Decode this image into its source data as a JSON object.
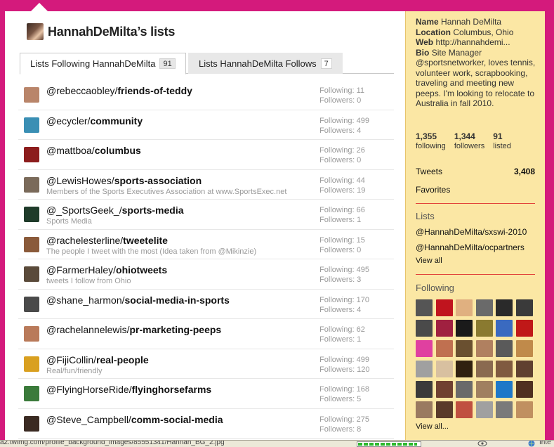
{
  "heading": {
    "title": "HannahDeMilta’s lists"
  },
  "tabs": [
    {
      "label": "Lists Following HannahDeMilta",
      "count": "91"
    },
    {
      "label": "Lists HannahDeMilta Follows",
      "count": "7"
    }
  ],
  "lists": [
    {
      "owner": "@rebeccaobley/",
      "name": "friends-of-teddy",
      "desc": "",
      "following": "Following: 11",
      "followers": "Followers: 0",
      "avatar": "#b9856a"
    },
    {
      "owner": "@ecycler/",
      "name": "community",
      "desc": "",
      "following": "Following: 499",
      "followers": "Followers: 4",
      "avatar": "#3a8fb4"
    },
    {
      "owner": "@mattboa/",
      "name": "columbus",
      "desc": "",
      "following": "Following: 26",
      "followers": "Followers: 0",
      "avatar": "#8c1d1d"
    },
    {
      "owner": "@LewisHowes/",
      "name": "sports-association",
      "desc": "Members of the Sports Executives Association at www.SportsExec.net",
      "following": "Following: 44",
      "followers": "Followers: 19",
      "avatar": "#7a6a5a"
    },
    {
      "owner": "@_SportsGeek_/",
      "name": "sports-media",
      "desc": "Sports Media",
      "following": "Following: 66",
      "followers": "Followers: 1",
      "avatar": "#1f3b2a"
    },
    {
      "owner": "@rachelesterline/",
      "name": "tweetelite",
      "desc": "The people I tweet with the most (Idea taken from @Mikinzie)",
      "following": "Following: 15",
      "followers": "Followers: 0",
      "avatar": "#8a5a3a"
    },
    {
      "owner": "@FarmerHaley/",
      "name": "ohiotweets",
      "desc": "tweets I follow  from Ohio",
      "following": "Following: 495",
      "followers": "Followers: 3",
      "avatar": "#5a4a3a"
    },
    {
      "owner": "@shane_harmon/",
      "name": "social-media-in-sports",
      "desc": "",
      "following": "Following: 170",
      "followers": "Followers: 4",
      "avatar": "#4a4a4a"
    },
    {
      "owner": "@rachelannelewis/",
      "name": "pr-marketing-peeps",
      "desc": "",
      "following": "Following: 62",
      "followers": "Followers: 1",
      "avatar": "#b97a5a"
    },
    {
      "owner": "@FijiCollin/",
      "name": "real-people",
      "desc": "Real/fun/friendly",
      "following": "Following: 499",
      "followers": "Followers: 120",
      "avatar": "#d9a020"
    },
    {
      "owner": "@FlyingHorseRide/",
      "name": "flyinghorsefarms",
      "desc": "",
      "following": "Following: 168",
      "followers": "Followers: 5",
      "avatar": "#3a7a3a"
    },
    {
      "owner": "@Steve_Campbell/",
      "name": "comm-social-media",
      "desc": "",
      "following": "Following: 275",
      "followers": "Followers: 8",
      "avatar": "#3a2a22"
    }
  ],
  "sidebar": {
    "name_label": "Name",
    "name_value": "Hannah DeMilta",
    "location_label": "Location",
    "location_value": "Columbus, Ohio",
    "web_label": "Web",
    "web_value": "http://hannahdemi...",
    "bio_label": "Bio",
    "bio_value": "Site Manager @sportsnetworker, loves tennis, volunteer work, scrapbooking, traveling and meeting new peeps. I'm looking to relocate to Australia in fall 2010.",
    "stats": [
      {
        "num": "1,355",
        "label": "following"
      },
      {
        "num": "1,344",
        "label": "followers"
      },
      {
        "num": "91",
        "label": "listed"
      }
    ],
    "tweets_label": "Tweets",
    "tweets_count": "3,408",
    "favorites_label": "Favorites",
    "lists_heading": "Lists",
    "lists": [
      "@HannahDeMilta/sxswi-2010",
      "@HannahDeMilta/ocpartners"
    ],
    "lists_view_all": "View all",
    "following_heading": "Following",
    "following_view_all": "View all...",
    "following_thumbs": [
      "#555555",
      "#c0141e",
      "#e0b080",
      "#6a6a6a",
      "#2a2a2a",
      "#3a3a3a",
      "#4a4a4a",
      "#a02040",
      "#1a1a1a",
      "#8a7a30",
      "#3a6ac0",
      "#c01818",
      "#e040a0",
      "#c07050",
      "#6a5030",
      "#b08060",
      "#5a5a5a",
      "#c08a4a",
      "#a0a0a0",
      "#d8c0a0",
      "#302010",
      "#8a6a50",
      "#805a40",
      "#604030",
      "#3a3a3a",
      "#704030",
      "#6a6a6a",
      "#a08060",
      "#1e78c8",
      "#503020",
      "#9a7a60",
      "#5a3a2a",
      "#c05040",
      "#a0a0a0",
      "#7a7a7a",
      "#c09060"
    ]
  },
  "statusbar": {
    "url": "a2.twimg.com/profile_background_images/85551341/Hannah_BG_2.jpg",
    "zone": "Inte",
    "progress_pct": 95
  }
}
